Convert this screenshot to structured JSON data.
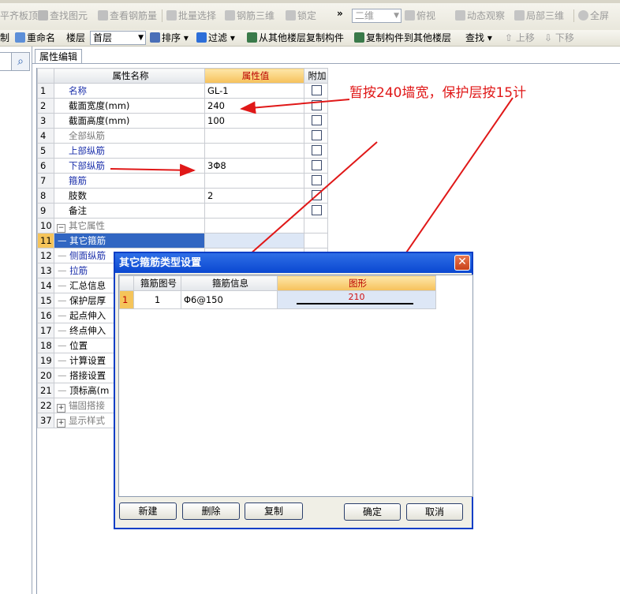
{
  "toolbar1": {
    "items": [
      "平齐板顶",
      "查找图元",
      "查看钢筋量",
      "批量选择",
      "钢筋三维",
      "锁定",
      "二维",
      "俯视",
      "动态观察",
      "局部三维",
      "全屏"
    ],
    "overflow": "»"
  },
  "toolbar2": {
    "items": [
      "制",
      "重命名",
      "楼层",
      "排序",
      "过滤",
      "从其他楼层复制构件",
      "复制构件到其他楼层",
      "查找",
      "上移",
      "下移"
    ],
    "floor_value": "首层"
  },
  "tab": {
    "label": "属性编辑"
  },
  "grid": {
    "headers": [
      "属性名称",
      "属性值",
      "附加"
    ],
    "rows": [
      {
        "num": "1",
        "name": "名称",
        "value": "GL-1"
      },
      {
        "num": "2",
        "name": "截面宽度(mm)",
        "value": "240"
      },
      {
        "num": "3",
        "name": "截面高度(mm)",
        "value": "100"
      },
      {
        "num": "4",
        "name": "全部纵筋",
        "value": ""
      },
      {
        "num": "5",
        "name": "上部纵筋",
        "value": ""
      },
      {
        "num": "6",
        "name": "下部纵筋",
        "value": "3Φ8"
      },
      {
        "num": "7",
        "name": "箍筋",
        "value": ""
      },
      {
        "num": "8",
        "name": "肢数",
        "value": "2"
      },
      {
        "num": "9",
        "name": "备注",
        "value": ""
      },
      {
        "num": "10",
        "name": "其它属性",
        "value": ""
      },
      {
        "num": "11",
        "name": "其它箍筋",
        "value": ""
      },
      {
        "num": "12",
        "name": "侧面纵筋",
        "value": ""
      },
      {
        "num": "13",
        "name": "拉筋",
        "value": ""
      },
      {
        "num": "14",
        "name": "汇总信息",
        "value": ""
      },
      {
        "num": "15",
        "name": "保护层厚",
        "value": ""
      },
      {
        "num": "16",
        "name": "起点伸入",
        "value": ""
      },
      {
        "num": "17",
        "name": "终点伸入",
        "value": ""
      },
      {
        "num": "18",
        "name": "位置",
        "value": ""
      },
      {
        "num": "19",
        "name": "计算设置",
        "value": ""
      },
      {
        "num": "20",
        "name": "搭接设置",
        "value": ""
      },
      {
        "num": "21",
        "name": "顶标高(m",
        "value": ""
      },
      {
        "num": "22",
        "name": "锚固搭接",
        "value": ""
      },
      {
        "num": "37",
        "name": "显示样式",
        "value": ""
      }
    ]
  },
  "dialog": {
    "title": "其它箍筋类型设置",
    "close_glyph": "✕",
    "headers": [
      "箍筋图号",
      "箍筋信息",
      "图形"
    ],
    "rows": [
      {
        "num": "1",
        "shape_no": "1",
        "info": "Φ6@150",
        "dim": "210"
      }
    ],
    "buttons": {
      "new": "新建",
      "delete": "删除",
      "copy": "复制",
      "ok": "确定",
      "cancel": "取消"
    }
  },
  "annotation": {
    "text": "暂按240墙宽，保护层按15计",
    "color": "#e01818"
  },
  "colors": {
    "selection": "#3166c2",
    "header_highlight": "#f6c15a",
    "dialog_title": "#0a47d1"
  }
}
